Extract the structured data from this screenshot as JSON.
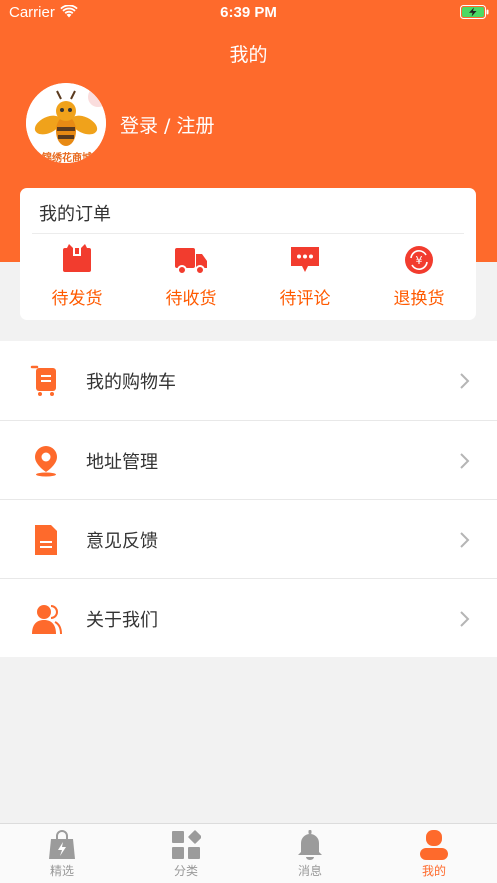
{
  "status_bar": {
    "carrier": "Carrier",
    "time": "6:39 PM"
  },
  "header": {
    "title": "我的",
    "login_label": "登录 / 注册",
    "avatar_caption": "锦绣花商城"
  },
  "orders": {
    "title": "我的订单",
    "items": [
      {
        "label": "待发货",
        "icon": "package-icon"
      },
      {
        "label": "待收货",
        "icon": "truck-icon"
      },
      {
        "label": "待评论",
        "icon": "comment-icon"
      },
      {
        "label": "退换货",
        "icon": "refund-icon"
      }
    ]
  },
  "menu": {
    "items": [
      {
        "label": "我的购物车",
        "icon": "cart-icon"
      },
      {
        "label": "地址管理",
        "icon": "location-icon"
      },
      {
        "label": "意见反馈",
        "icon": "document-icon"
      },
      {
        "label": "关于我们",
        "icon": "people-icon"
      }
    ]
  },
  "tabbar": {
    "active": "我的",
    "items": [
      {
        "label": "精选",
        "icon": "shopping-bag-icon"
      },
      {
        "label": "分类",
        "icon": "grid-icon"
      },
      {
        "label": "消息",
        "icon": "bell-icon"
      },
      {
        "label": "我的",
        "icon": "user-icon"
      }
    ]
  },
  "colors": {
    "accent": "#fe6a2c",
    "order_label": "#ff5a00",
    "icon_red": "#f23c2e",
    "background": "#f2f2f2"
  }
}
